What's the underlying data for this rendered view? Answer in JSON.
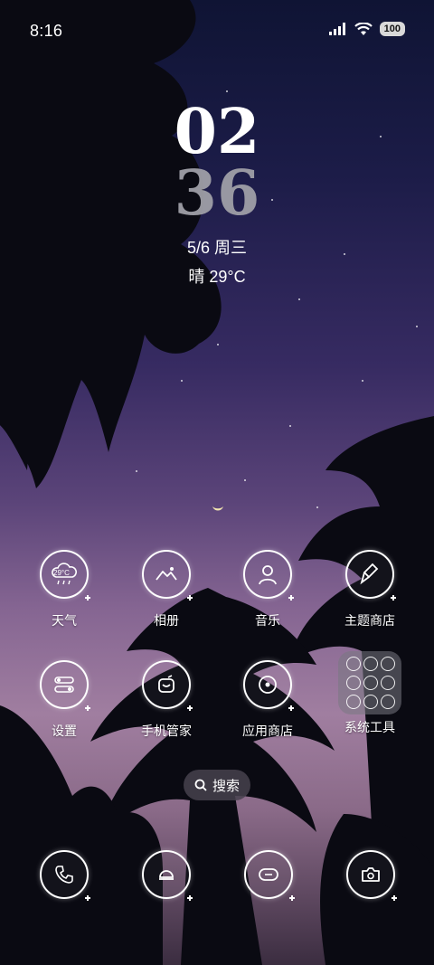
{
  "status_bar": {
    "time": "8:16",
    "battery": "100",
    "icons": [
      "signal-icon",
      "wifi-icon",
      "battery-icon"
    ]
  },
  "lockclock": {
    "hour": "02",
    "minute": "36",
    "date": "5/6 周三",
    "weather": "晴 29°C"
  },
  "apps_row1": [
    {
      "label": "天气",
      "icon": "weather-icon",
      "badge": "29°C"
    },
    {
      "label": "相册",
      "icon": "gallery-icon"
    },
    {
      "label": "音乐",
      "icon": "music-icon"
    },
    {
      "label": "主题商店",
      "icon": "theme-store-icon"
    }
  ],
  "apps_row2": [
    {
      "label": "设置",
      "icon": "settings-icon"
    },
    {
      "label": "手机管家",
      "icon": "phone-manager-icon"
    },
    {
      "label": "应用商店",
      "icon": "app-store-icon"
    },
    {
      "label": "系统工具",
      "icon": "folder-icon"
    }
  ],
  "search": {
    "label": "搜索"
  },
  "dock": [
    {
      "icon": "phone-icon"
    },
    {
      "icon": "browser-icon"
    },
    {
      "icon": "messages-icon"
    },
    {
      "icon": "camera-icon"
    }
  ],
  "colors": {
    "sky_top": "#0f1434",
    "sky_mid": "#5b4479",
    "sky_bottom": "#a07ea0",
    "icon_stroke": "#ffffff",
    "minute_color": "#9f9fa7"
  }
}
